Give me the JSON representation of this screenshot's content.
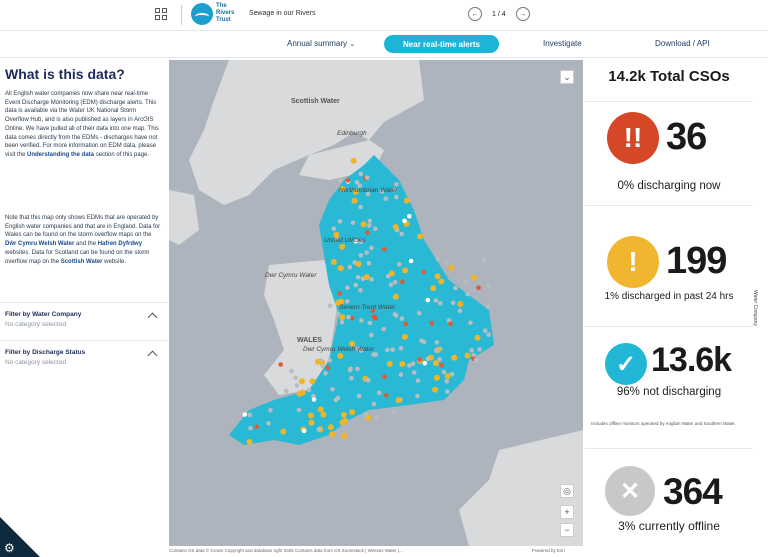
{
  "header": {
    "logo_text": "The Rivers Trust",
    "title": "Sewage in our Rivers",
    "pager": "1 / 4",
    "prev_icon": "arrow-left-icon",
    "next_icon": "arrow-right-icon"
  },
  "nav": {
    "items": [
      "Annual summary",
      "Near real-time alerts",
      "Investigate",
      "Download / API"
    ],
    "active_index": 1,
    "active_color": "#1cb5d8"
  },
  "left": {
    "title": "What is this data?",
    "para1_a": "All English water companies now share near real-time Event Discharge Monitoring (EDM) discharge alerts. This data is available via the Water UK National Storm Overflow Hub, and is also published as layers in ArcGIS Online. We have pulled all of their data into one map. This data comes directly from the EDMs - discharges have not been verified. For more information on EDM data, please visit the ",
    "para1_link": "Understanding the data",
    "para1_b": " section of this page.",
    "para2_a": "Note that this map only shows EDMs that are operated by English water companies and that are in England. Data for Wales can be found on the storm overflow maps on the ",
    "para2_link1": "Dŵr Cymru Welsh Water",
    "para2_mid": " and the ",
    "para2_link2": "Hafren Dyfrdwy",
    "para2_c": " websites. Data for Scotland can be found on the storm overflow map on the ",
    "para2_link3": "Scottish Water",
    "para2_d": " website.",
    "filters": [
      {
        "title": "Filter by Water Company",
        "value": "No category selected"
      },
      {
        "title": "Filter by Discharge Status",
        "value": "No category selected"
      }
    ]
  },
  "map": {
    "labels": {
      "scottish_water": "Scottish Water",
      "edinburgh": "Edinburgh",
      "northumbrian": "Northumbrian Water",
      "united_utilities": "United Utilities",
      "dwr_cymru": "Dwr Cymru Water",
      "severn_trent": "Severn Trent Water",
      "wales": "WALES",
      "dwr_cymru_welsh": "Dwr Cymru Welsh Water"
    },
    "attribution": "Contains OS data © Crown Copyright and database right 2025 Contains data from OS Zoomstack | Wessex Water |...",
    "powered_by": "Powered by Esri",
    "colors": {
      "sea": "#aeb4bd",
      "land": "#d9dadc",
      "england": "#29b9d4",
      "alert": "#f0b429",
      "discharging": "#e05a35",
      "offline": "#b9bcc1"
    }
  },
  "right": {
    "total": "14.2k Total CSOs",
    "stats": [
      {
        "icon": "double-exclamation-icon",
        "glyph": "!!",
        "color": "#d64727",
        "value": "36",
        "label": "0% discharging now"
      },
      {
        "icon": "exclamation-icon",
        "glyph": "!",
        "color": "#f1b52f",
        "value": "199",
        "label": "1% discharged in past 24 hrs"
      },
      {
        "icon": "check-icon",
        "glyph": "✓",
        "color": "#22b7d6",
        "value": "13.6k",
        "label": "96% not discharging"
      },
      {
        "icon": "close-icon",
        "glyph": "✕",
        "color": "#c8c8c8",
        "value": "364",
        "label": "3% currently offline"
      }
    ],
    "note": "Includes offline monitors operated by Anglian Water and Southern Water.",
    "side_tab": "Water Company"
  }
}
